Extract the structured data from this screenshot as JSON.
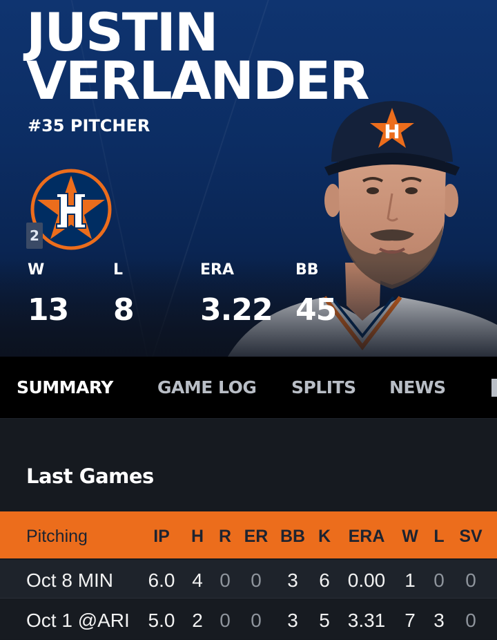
{
  "player": {
    "first_name": "JUSTIN",
    "last_name": "VERLANDER",
    "number_position": "#35 PITCHER",
    "team_logo": "astros-star-h-logo",
    "logo_tag": "2"
  },
  "colors": {
    "hero_blue": "#0c2d63",
    "astros_orange": "#ec6d1c",
    "astros_navy": "#002d62",
    "tab_bar": "#000000"
  },
  "stats": [
    {
      "label": "W",
      "value": "13"
    },
    {
      "label": "L",
      "value": "8"
    },
    {
      "label": "ERA",
      "value": "3.22"
    },
    {
      "label": "BB",
      "value": "45"
    }
  ],
  "tabs": [
    {
      "label": "SUMMARY",
      "active": true
    },
    {
      "label": "GAME LOG",
      "active": false
    },
    {
      "label": "SPLITS",
      "active": false
    },
    {
      "label": "NEWS",
      "active": false
    }
  ],
  "last_games": {
    "title": "Last Games",
    "headers": [
      "Pitching",
      "IP",
      "H",
      "R",
      "ER",
      "BB",
      "K",
      "ERA",
      "W",
      "L",
      "SV"
    ],
    "rows": [
      [
        "Oct 8 MIN",
        "6.0",
        "4",
        "0",
        "0",
        "3",
        "6",
        "0.00",
        "1",
        "0",
        "0"
      ],
      [
        "Oct 1 @ARI",
        "5.0",
        "2",
        "0",
        "0",
        "3",
        "5",
        "3.31",
        "7",
        "3",
        "0"
      ]
    ]
  }
}
